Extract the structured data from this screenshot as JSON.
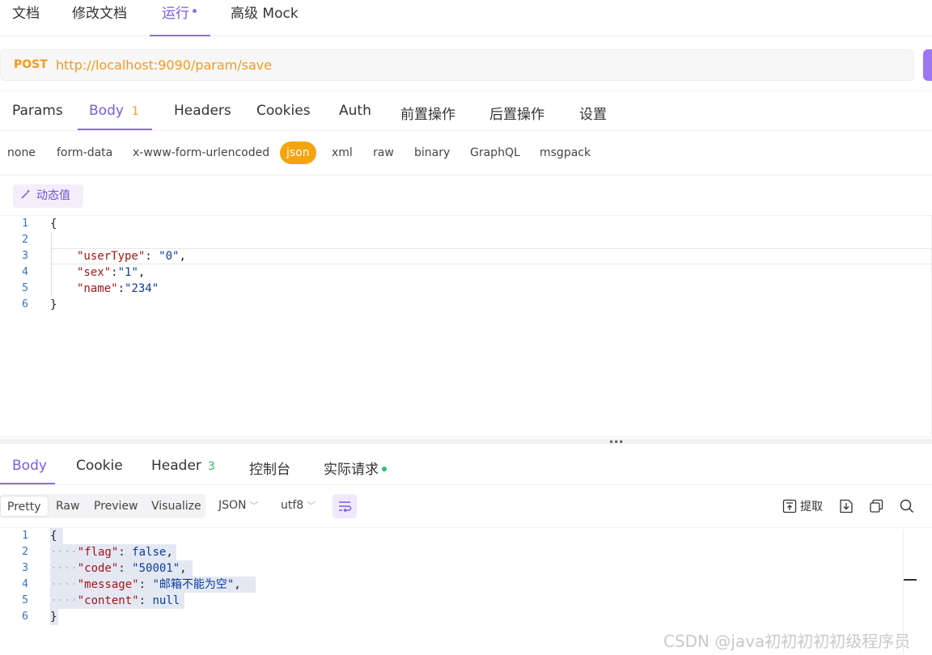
{
  "top_tabs": [
    {
      "label": "文档"
    },
    {
      "label": "修改文档"
    },
    {
      "label": "运行"
    },
    {
      "label": "高级 Mock"
    }
  ],
  "request": {
    "method": "POST",
    "url": "http://localhost:9090/param/save"
  },
  "request_tabs": [
    {
      "label": "Params"
    },
    {
      "label": "Body",
      "badge": "1"
    },
    {
      "label": "Headers"
    },
    {
      "label": "Cookies"
    },
    {
      "label": "Auth"
    },
    {
      "label": "前置操作"
    },
    {
      "label": "后置操作"
    },
    {
      "label": "设置"
    }
  ],
  "body_types": [
    "none",
    "form-data",
    "x-www-form-urlencoded",
    "json",
    "xml",
    "raw",
    "binary",
    "GraphQL",
    "msgpack"
  ],
  "dynamic_value_label": "动态值",
  "request_body": {
    "line_numbers": [
      "1",
      "2",
      "3",
      "4",
      "5",
      "6"
    ],
    "open_brace": "{",
    "l3_key": "\"userType\"",
    "l3_sep": ": ",
    "l3_val": "\"0\"",
    "l3_end": ",",
    "l4_key": "\"sex\"",
    "l4_sep": ":",
    "l4_val": "\"1\"",
    "l4_end": ",",
    "l5_key": "\"name\"",
    "l5_sep": ":",
    "l5_val": "\"234\"",
    "close_brace": "}"
  },
  "response_tabs": [
    {
      "label": "Body"
    },
    {
      "label": "Cookie"
    },
    {
      "label": "Header",
      "badge": "3"
    },
    {
      "label": "控制台"
    },
    {
      "label": "实际请求"
    }
  ],
  "view_modes": [
    "Pretty",
    "Raw",
    "Preview",
    "Visualize"
  ],
  "format_select": "JSON",
  "charset_select": "utf8",
  "extract_label": "提取",
  "response_body": {
    "line_numbers": [
      "1",
      "2",
      "3",
      "4",
      "5",
      "6"
    ],
    "open_brace": "{",
    "indent": "····",
    "l2_key": "\"flag\"",
    "l2_sep": ": ",
    "l2_val": "false",
    "l2_end": ",",
    "l3_key": "\"code\"",
    "l3_sep": ": ",
    "l3_val": "\"50001\"",
    "l3_end": ",",
    "l4_key": "\"message\"",
    "l4_sep": ": ",
    "l4_val": "\"邮箱不能为空\"",
    "l4_end": ",",
    "l5_key": "\"content\"",
    "l5_sep": ": ",
    "l5_val": "null",
    "close_brace": "}"
  },
  "watermark": "CSDN @java初初初初初级程序员",
  "colors": {
    "accent": "#8b6cf0",
    "method": "#f39b1c",
    "json_chip": "#f5a40f",
    "status_dot": "#2fbf71"
  }
}
